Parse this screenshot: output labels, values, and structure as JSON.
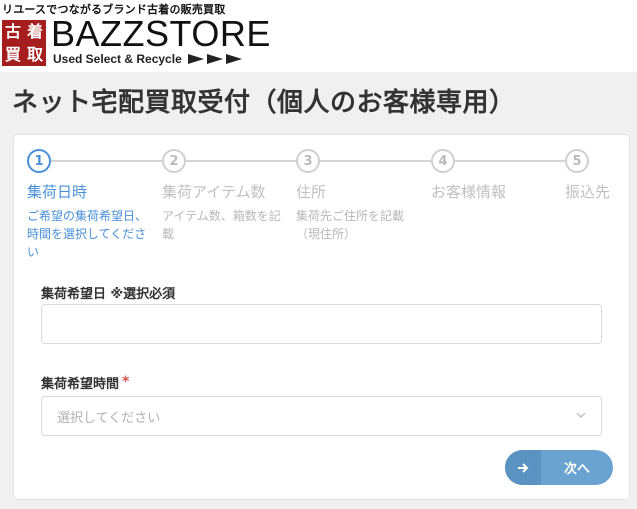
{
  "header": {
    "tagline": "リユースでつながるブランド古着の販売買取",
    "logo_chars": [
      "古",
      "着",
      "買",
      "取"
    ],
    "brand": "BAZZSTORE",
    "brand_sub": "Used Select & Recycle",
    "brand_color": "#a51d1d"
  },
  "page_title": "ネット宅配買取受付（個人のお客様専用）",
  "steps": [
    {
      "number": "1",
      "label": "集荷日時",
      "desc": "ご希望の集荷希望日、時間を選択してください",
      "active": true
    },
    {
      "number": "2",
      "label": "集荷アイテム数",
      "desc": "アイテム数、箱数を記載",
      "active": false
    },
    {
      "number": "3",
      "label": "住所",
      "desc": "集荷先ご住所を記載（現住所）",
      "active": false
    },
    {
      "number": "4",
      "label": "お客様情報",
      "desc": "",
      "active": false
    },
    {
      "number": "5",
      "label": "振込先",
      "desc": "",
      "active": false
    }
  ],
  "form": {
    "date_label": "集荷希望日 ※選択必須",
    "date_value": "",
    "time_label": "集荷希望時間",
    "time_required_mark": "*",
    "time_placeholder": "選択してください"
  },
  "next_button": {
    "label": "次へ",
    "icon": "arrow-right-icon"
  },
  "colors": {
    "accent": "#4a90d9",
    "button": "#6aa3cf",
    "required": "#d9534f"
  }
}
